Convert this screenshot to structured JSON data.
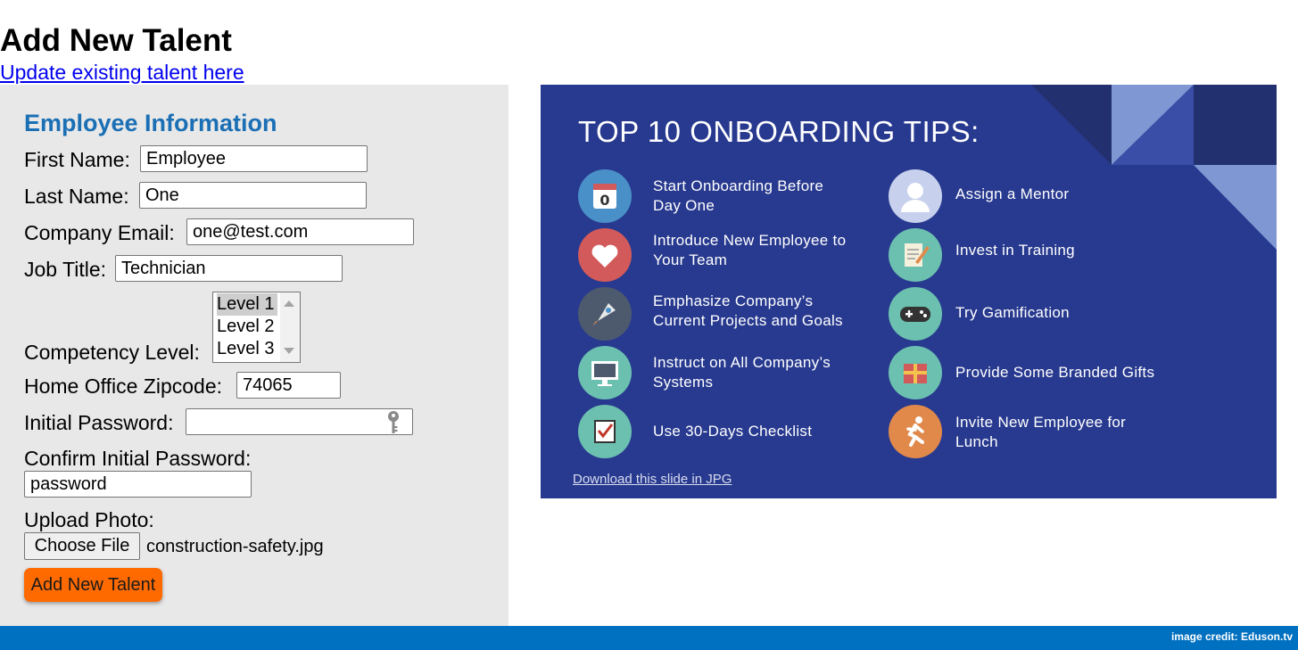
{
  "page": {
    "title": "Add New Talent",
    "update_link": "Update existing talent here"
  },
  "form": {
    "section_title": "Employee Information",
    "first_name": {
      "label": "First Name:",
      "value": "Employee"
    },
    "last_name": {
      "label": "Last Name:",
      "value": "One"
    },
    "email": {
      "label": "Company Email:",
      "value": "one@test.com"
    },
    "job_title": {
      "label": "Job Title:",
      "value": "Technician"
    },
    "competency": {
      "label": "Competency Level:",
      "options": [
        "Level 1",
        "Level 2",
        "Level 3"
      ],
      "selected": "Level 1"
    },
    "zipcode": {
      "label": "Home Office Zipcode:",
      "value": "74065"
    },
    "initial_password": {
      "label": "Initial Password:",
      "value": ""
    },
    "confirm_password": {
      "label": "Confirm Initial Password:",
      "value": "password"
    },
    "upload": {
      "label": "Upload Photo:",
      "button": "Choose File",
      "file_name": "construction-safety.jpg"
    },
    "submit_label": "Add New Talent"
  },
  "slide": {
    "title": "TOP 10 ONBOARDING TIPS:",
    "tips_left": [
      {
        "line1": "Start Onboarding Before",
        "line2": "Day One",
        "icon": "calendar-icon",
        "color": "#4a90c8"
      },
      {
        "line1": "Introduce New Employee to",
        "line2": "Your Team",
        "icon": "heart-icon",
        "color": "#d25a5a"
      },
      {
        "line1": "Emphasize Company’s",
        "line2": "Current Projects and Goals",
        "icon": "rocket-icon",
        "color": "#4d5a6e"
      },
      {
        "line1": "Instruct on All Company’s",
        "line2": "Systems",
        "icon": "monitor-icon",
        "color": "#6cc0b0"
      },
      {
        "line1": "Use 30-Days Checklist",
        "line2": "",
        "icon": "checklist-icon",
        "color": "#6cc0b0"
      }
    ],
    "tips_right": [
      {
        "line1": "Assign a Mentor",
        "line2": "",
        "icon": "person-icon",
        "color": "#c7d0ec"
      },
      {
        "line1": "Invest in Training",
        "line2": "",
        "icon": "notepad-icon",
        "color": "#6cc0b0"
      },
      {
        "line1": "Try Gamification",
        "line2": "",
        "icon": "gamepad-icon",
        "color": "#6cc0b0"
      },
      {
        "line1": "Provide Some Branded Gifts",
        "line2": "",
        "icon": "gift-icon",
        "color": "#6cc0b0"
      },
      {
        "line1": "Invite New Employee for",
        "line2": "Lunch",
        "icon": "runner-icon",
        "color": "#e0894a"
      }
    ],
    "download_link": "Download this slide in JPG"
  },
  "footer": {
    "credit": "image credit: Eduson.tv"
  },
  "colors": {
    "heading_blue": "#1a6fb5",
    "button_orange": "#ff6a00",
    "footer_blue": "#0070c0",
    "slide_bg": "#283a8f",
    "panel_gray": "#e8e8e8"
  }
}
